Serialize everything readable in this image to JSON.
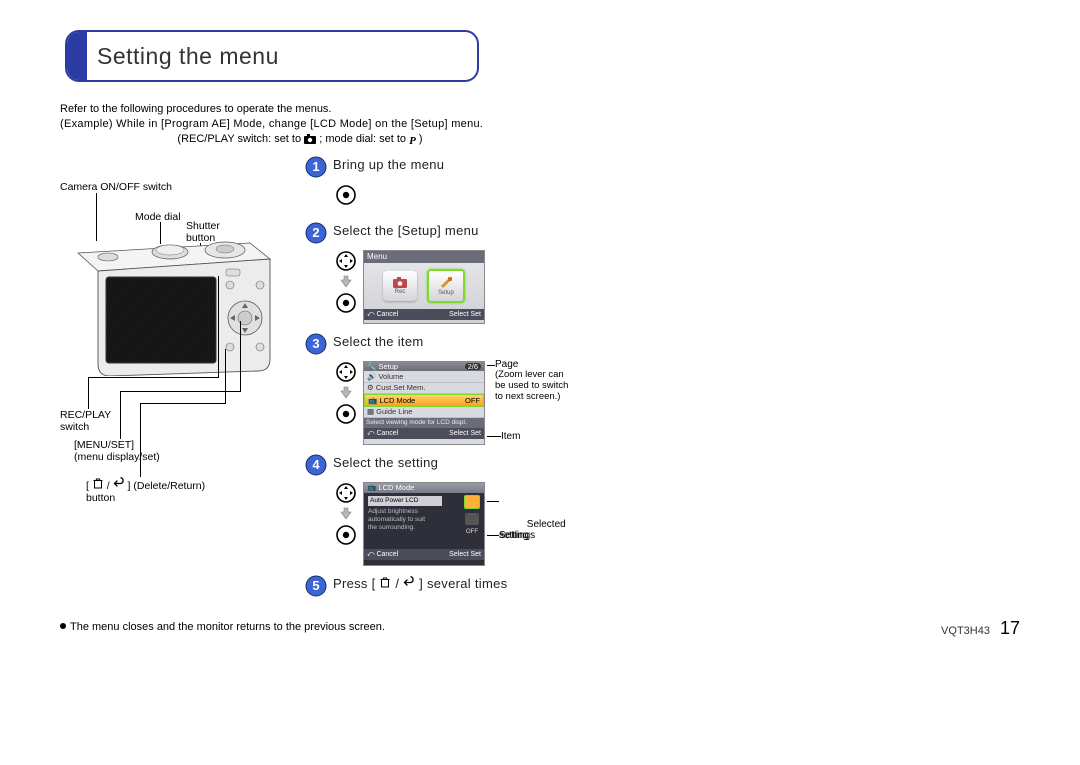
{
  "title": "Setting the menu",
  "intro": {
    "line1": "Refer to the following procedures to operate the menus.",
    "line2_prefix": "(Example) While in [Program AE] Mode, change [LCD Mode] on the [Setup] menu.",
    "line3_a": "(REC/PLAY switch: set to ",
    "line3_b": "; mode dial: set to ",
    "line3_c": ")"
  },
  "camera_labels": {
    "onoff": "Camera ON/OFF switch",
    "mode_dial": "Mode dial",
    "shutter": "Shutter\nbutton",
    "recplay": "REC/PLAY\nswitch",
    "menuset_a": "[MENU/SET]",
    "menuset_b": "(menu display/set)",
    "delret_a": "[",
    "delret_b": " / ",
    "delret_c": "] (Delete/Return)",
    "delret_d": "button"
  },
  "steps": {
    "s1": "Bring up the menu",
    "s2": "Select the [Setup] menu",
    "s3": "Select the item",
    "s4": "Select the setting",
    "s5_a": "Press [",
    "s5_b": " / ",
    "s5_c": "] several times"
  },
  "lcd_menu": {
    "title": "Menu",
    "rec_label": "Rec",
    "setup_label": "Setup",
    "cancel": "Cancel",
    "select_set": "Select   Set"
  },
  "lcd_setup": {
    "hdr": "Setup",
    "page_ind": "2/6",
    "row1": "Volume",
    "row2": "Cust.Set Mem.",
    "row3_l": "LCD Mode",
    "row3_r": "OFF",
    "row4": "Guide Line",
    "info": "Select viewing mode for LCD displ.",
    "cancel": "Cancel",
    "select_set": "Select   Set"
  },
  "lcd_mode": {
    "hdr": "LCD Mode",
    "sub_title": "Auto Power LCD",
    "desc": "Adjust brightness\nautomatically to suit\nthe surrounding.",
    "off": "OFF",
    "cancel": "Cancel",
    "select_set": "Select   Set"
  },
  "callouts": {
    "page": "Page",
    "page_note": "(Zoom lever can\nbe used to switch\nto next screen.)",
    "item": "Item",
    "selected_setting": "Selected\nsetting",
    "settings": "Settings"
  },
  "footnote": "The menu closes and the monitor returns to the previous screen.",
  "footer": {
    "code": "VQT3H43",
    "page": "17"
  }
}
